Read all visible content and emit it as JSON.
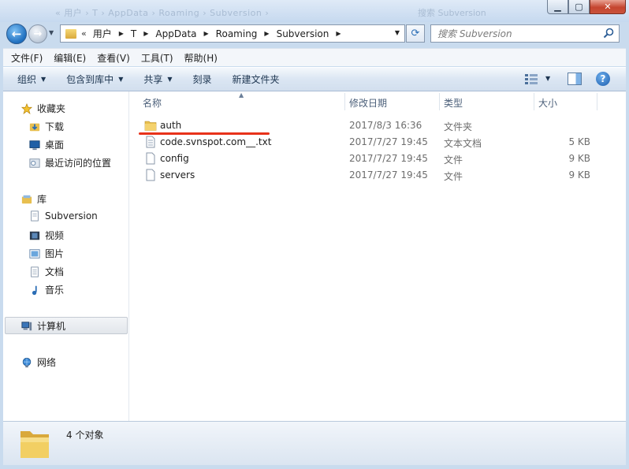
{
  "titlebar": {
    "ghost_path": "« 用户 › T › AppData › Roaming › Subversion ›",
    "ghost_right": "搜索 Subversion",
    "minimize_glyph": "▁",
    "maximize_glyph": "▢",
    "close_glyph": "✕"
  },
  "address": {
    "overflow": "«",
    "crumbs": [
      "用户",
      "T",
      "AppData",
      "Roaming",
      "Subversion"
    ],
    "search_placeholder": "搜索 Subversion"
  },
  "menu": [
    "文件(F)",
    "编辑(E)",
    "查看(V)",
    "工具(T)",
    "帮助(H)"
  ],
  "commands": {
    "organize": "组织",
    "include_library": "包含到库中",
    "share": "共享",
    "burn": "刻录",
    "new_folder": "新建文件夹",
    "help": "?"
  },
  "nav": {
    "favorites": "收藏夹",
    "downloads": "下载",
    "desktop": "桌面",
    "recent": "最近访问的位置",
    "libraries": "库",
    "subversion": "Subversion",
    "videos": "视频",
    "pictures": "图片",
    "documents": "文档",
    "music": "音乐",
    "computer": "计算机",
    "network": "网络"
  },
  "columns": {
    "name": "名称",
    "date": "修改日期",
    "type": "类型",
    "size": "大小"
  },
  "files": [
    {
      "name": "auth",
      "date": "2017/8/3 16:36",
      "type": "文件夹",
      "size": "",
      "icon": "folder-icon"
    },
    {
      "name": "code.svnspot.com__.txt",
      "date": "2017/7/27 19:45",
      "type": "文本文档",
      "size": "5 KB",
      "icon": "text-file-icon"
    },
    {
      "name": "config",
      "date": "2017/7/27 19:45",
      "type": "文件",
      "size": "9 KB",
      "icon": "file-icon"
    },
    {
      "name": "servers",
      "date": "2017/7/27 19:45",
      "type": "文件",
      "size": "9 KB",
      "icon": "file-icon"
    }
  ],
  "status": {
    "count": "4 个对象"
  },
  "colors": {
    "underline": "#e8321a",
    "window_frame": "#c9dbee",
    "folder": "#e8bf4f"
  }
}
